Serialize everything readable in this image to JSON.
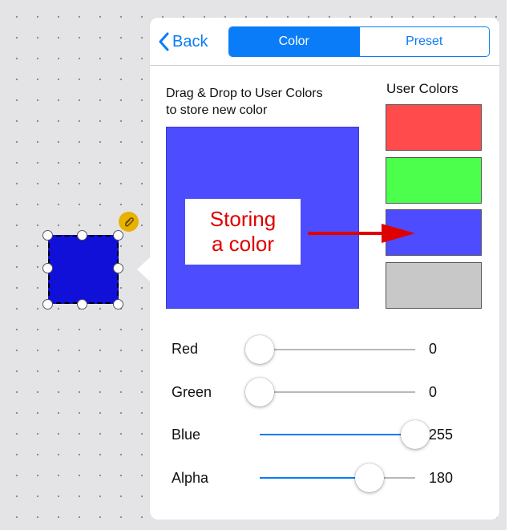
{
  "header": {
    "back_label": "Back",
    "tabs": [
      {
        "label": "Color",
        "selected": true
      },
      {
        "label": "Preset",
        "selected": false
      }
    ]
  },
  "instructions": [
    "Drag & Drop to User Colors",
    "to store new color"
  ],
  "user_colors": {
    "title": "User Colors",
    "swatches": [
      "#ff4b4b",
      "#4dff4d",
      "#4d4dff",
      "#c8c8c8"
    ]
  },
  "preview_color": "#4d4dff",
  "annotation": {
    "lines": [
      "Storing",
      "a color"
    ],
    "color": "#e00000"
  },
  "sliders": [
    {
      "label": "Red",
      "value": "0",
      "fraction": 0.0
    },
    {
      "label": "Green",
      "value": "0",
      "fraction": 0.0
    },
    {
      "label": "Blue",
      "value": "255",
      "fraction": 1.0
    },
    {
      "label": "Alpha",
      "value": "180",
      "fraction": 0.706
    }
  ],
  "selected_shape_color": "#1010d8",
  "accent_color": "#0a7cf7"
}
